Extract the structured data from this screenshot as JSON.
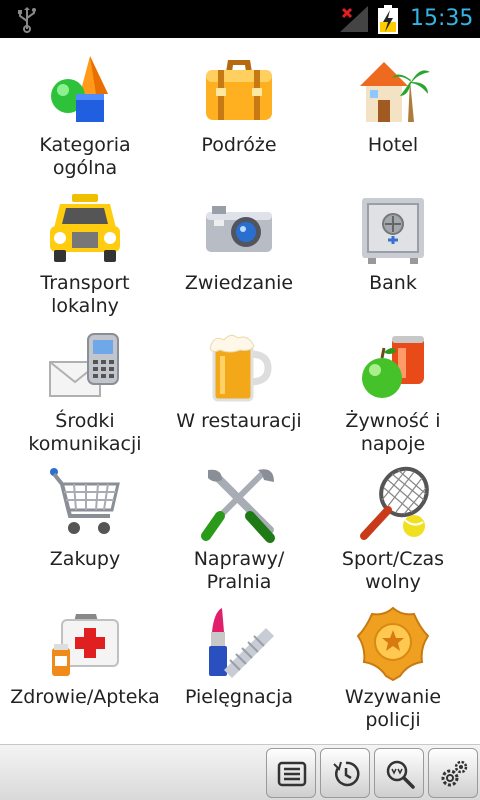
{
  "status_bar": {
    "time": "15:35"
  },
  "categories": [
    {
      "label": "Kategoria\nogólna",
      "icon": "shapes-icon"
    },
    {
      "label": "Podróże",
      "icon": "suitcase-icon"
    },
    {
      "label": "Hotel",
      "icon": "house-palm-icon"
    },
    {
      "label": "Transport\nlokalny",
      "icon": "taxi-icon"
    },
    {
      "label": "Zwiedzanie",
      "icon": "camera-icon"
    },
    {
      "label": "Bank",
      "icon": "safe-icon"
    },
    {
      "label": "Środki\nkomunikacji",
      "icon": "phone-envelope-icon"
    },
    {
      "label": "W restauracji",
      "icon": "beer-mug-icon"
    },
    {
      "label": "Żywność i\nnapoje",
      "icon": "apple-can-icon"
    },
    {
      "label": "Zakupy",
      "icon": "shopping-cart-icon"
    },
    {
      "label": "Naprawy/\nPralnia",
      "icon": "tools-icon"
    },
    {
      "label": "Sport/Czas\nwolny",
      "icon": "tennis-icon"
    },
    {
      "label": "Zdrowie/Apteka",
      "icon": "first-aid-kit-icon"
    },
    {
      "label": "Pielęgnacja",
      "icon": "lipstick-comb-icon"
    },
    {
      "label": "Wzywanie\npolicji",
      "icon": "police-badge-icon"
    }
  ],
  "toolbar": [
    {
      "icon": "list-icon"
    },
    {
      "icon": "history-icon"
    },
    {
      "icon": "search-icon"
    },
    {
      "icon": "settings-icon"
    }
  ],
  "colors": {
    "status_bar": "#000000",
    "clock": "#33b5e5",
    "label": "#222222"
  }
}
